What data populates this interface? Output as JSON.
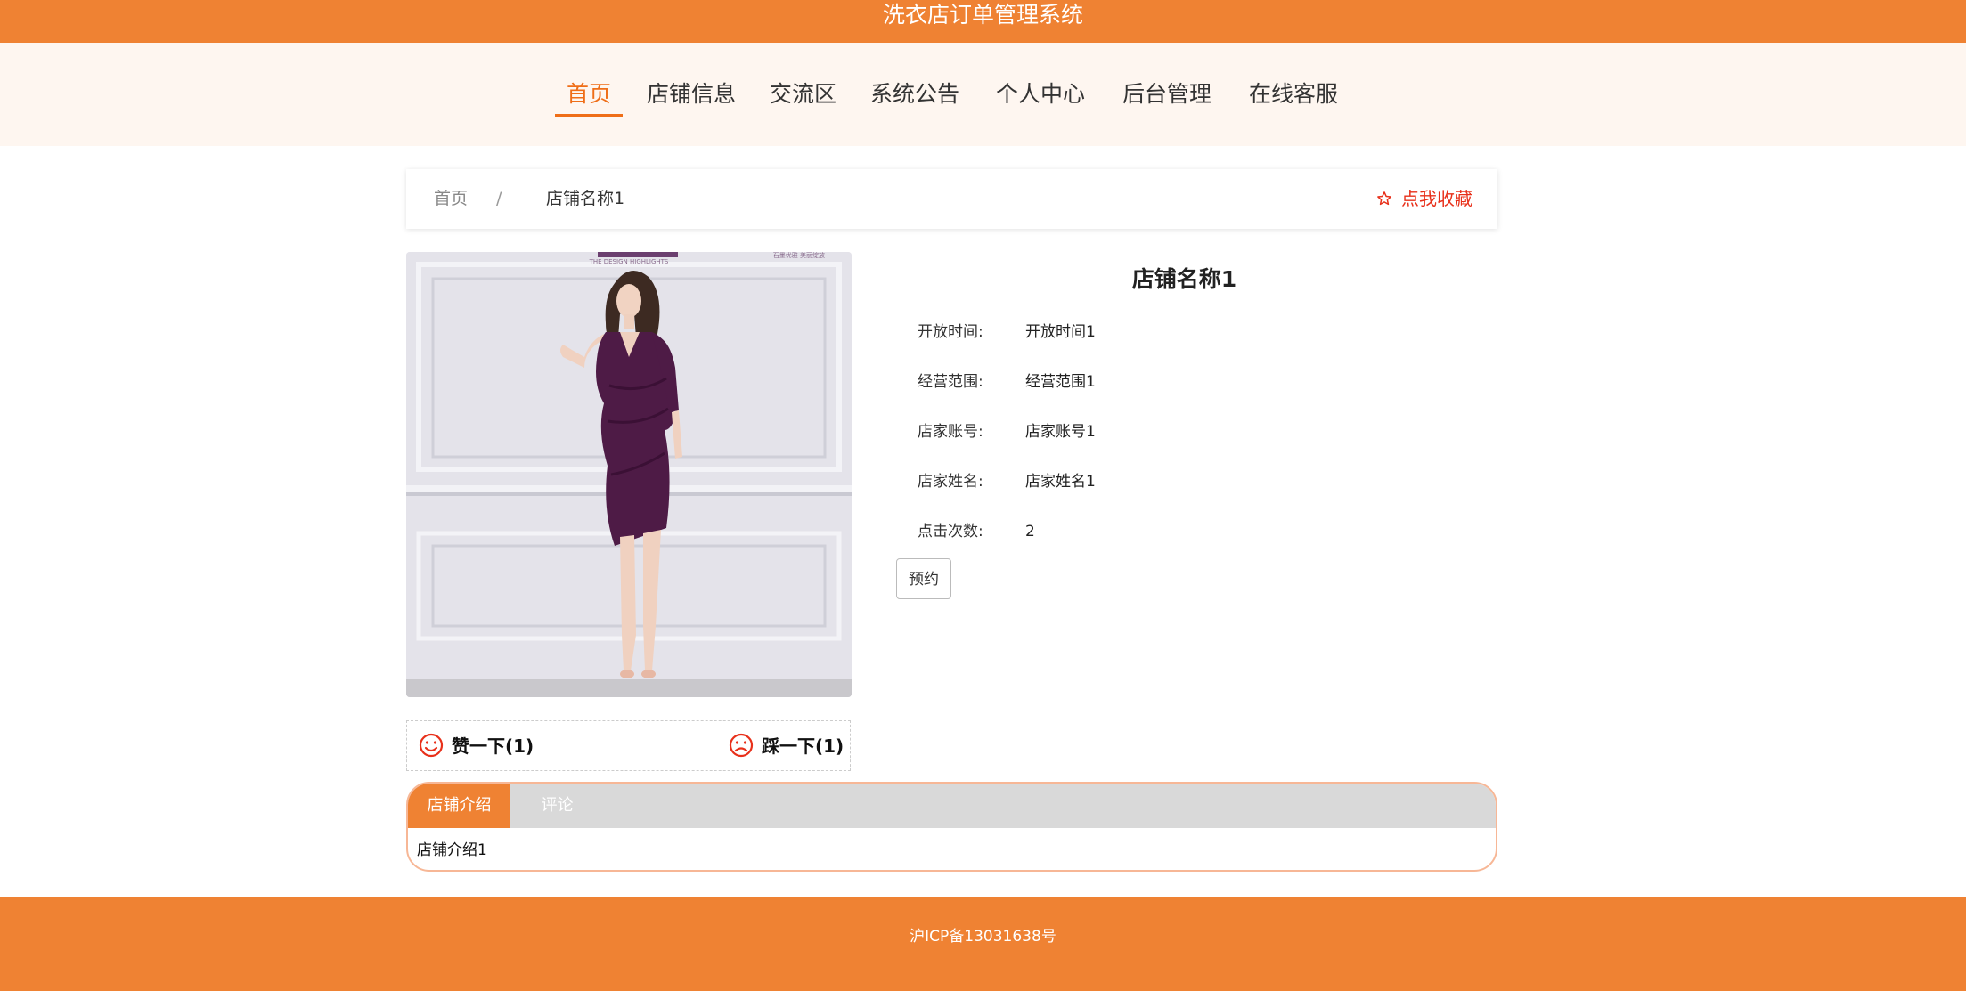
{
  "header": {
    "title": "洗衣店订单管理系统"
  },
  "nav": {
    "items": [
      {
        "label": "首页",
        "active": true
      },
      {
        "label": "店铺信息"
      },
      {
        "label": "交流区"
      },
      {
        "label": "系统公告"
      },
      {
        "label": "个人中心"
      },
      {
        "label": "后台管理"
      },
      {
        "label": "在线客服"
      }
    ]
  },
  "breadcrumb": {
    "home": "首页",
    "separator": "/",
    "current": "店铺名称1"
  },
  "favorite": {
    "label": "点我收藏",
    "icon": "star-outline-icon"
  },
  "shop": {
    "name": "店铺名称1",
    "fields": [
      {
        "label": "开放时间:",
        "value": "开放时间1"
      },
      {
        "label": "经营范围:",
        "value": "经营范围1"
      },
      {
        "label": "店家账号:",
        "value": "店家账号1"
      },
      {
        "label": "店家姓名:",
        "value": "店家姓名1"
      },
      {
        "label": "点击次数:",
        "value": "2"
      }
    ],
    "reserve_label": "预约"
  },
  "image": {
    "banner_text": "THE DESIGN HIGHLIGHTS",
    "corner_text": "石墨优雅 美丽绽放"
  },
  "votes": {
    "like_label": "赞一下(1)",
    "dislike_label": "踩一下(1)"
  },
  "tabs": {
    "items": [
      {
        "label": "店铺介绍",
        "active": true
      },
      {
        "label": "评论"
      }
    ],
    "content": "店铺介绍1"
  },
  "footer": {
    "text": "沪ICP备13031638号"
  },
  "colors": {
    "brand": "#ef8233",
    "accent": "#ef6e18",
    "favorite": "#e8301a",
    "nav_bg": "#fef6f0"
  }
}
